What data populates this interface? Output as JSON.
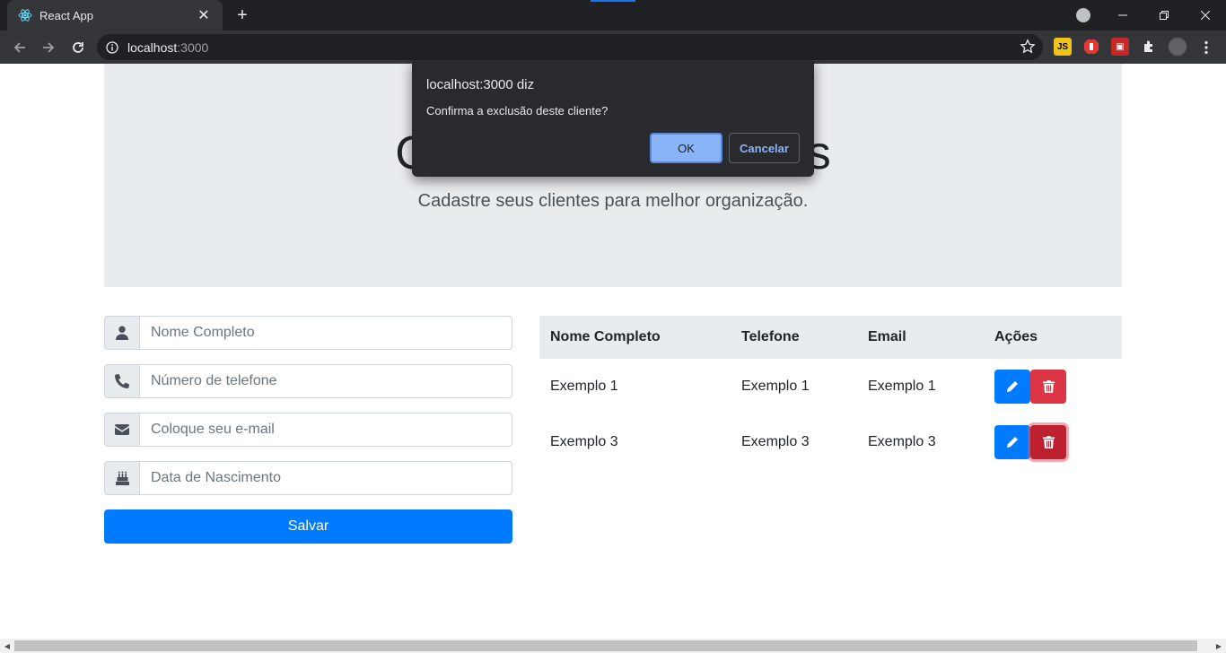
{
  "browser": {
    "tab_title": "React App",
    "url_host": "localhost",
    "url_port": ":3000",
    "extensions": [
      "js-extension-icon",
      "adblock-icon",
      "devtools-extension-icon",
      "puzzle-icon",
      "profile-avatar-icon"
    ]
  },
  "dialog": {
    "title": "localhost:3000 diz",
    "message": "Confirma a exclusão deste cliente?",
    "ok_label": "OK",
    "cancel_label": "Cancelar"
  },
  "header": {
    "title": "Cadastro de Clientes",
    "lead": "Cadastre seus clientes para melhor organização."
  },
  "form": {
    "name_placeholder": "Nome Completo",
    "phone_placeholder": "Número de telefone",
    "email_placeholder": "Coloque seu e-mail",
    "birth_placeholder": "Data de Nascimento",
    "save_label": "Salvar"
  },
  "table": {
    "headers": [
      "Nome Completo",
      "Telefone",
      "Email",
      "Ações"
    ],
    "rows": [
      [
        "Exemplo 1",
        "Exemplo 1",
        "Exemplo 1"
      ],
      [
        "Exemplo 3",
        "Exemplo 3",
        "Exemplo 3"
      ]
    ]
  },
  "colors": {
    "primary": "#007bff",
    "danger": "#dc3545",
    "jumbotron": "#e9ecef"
  }
}
